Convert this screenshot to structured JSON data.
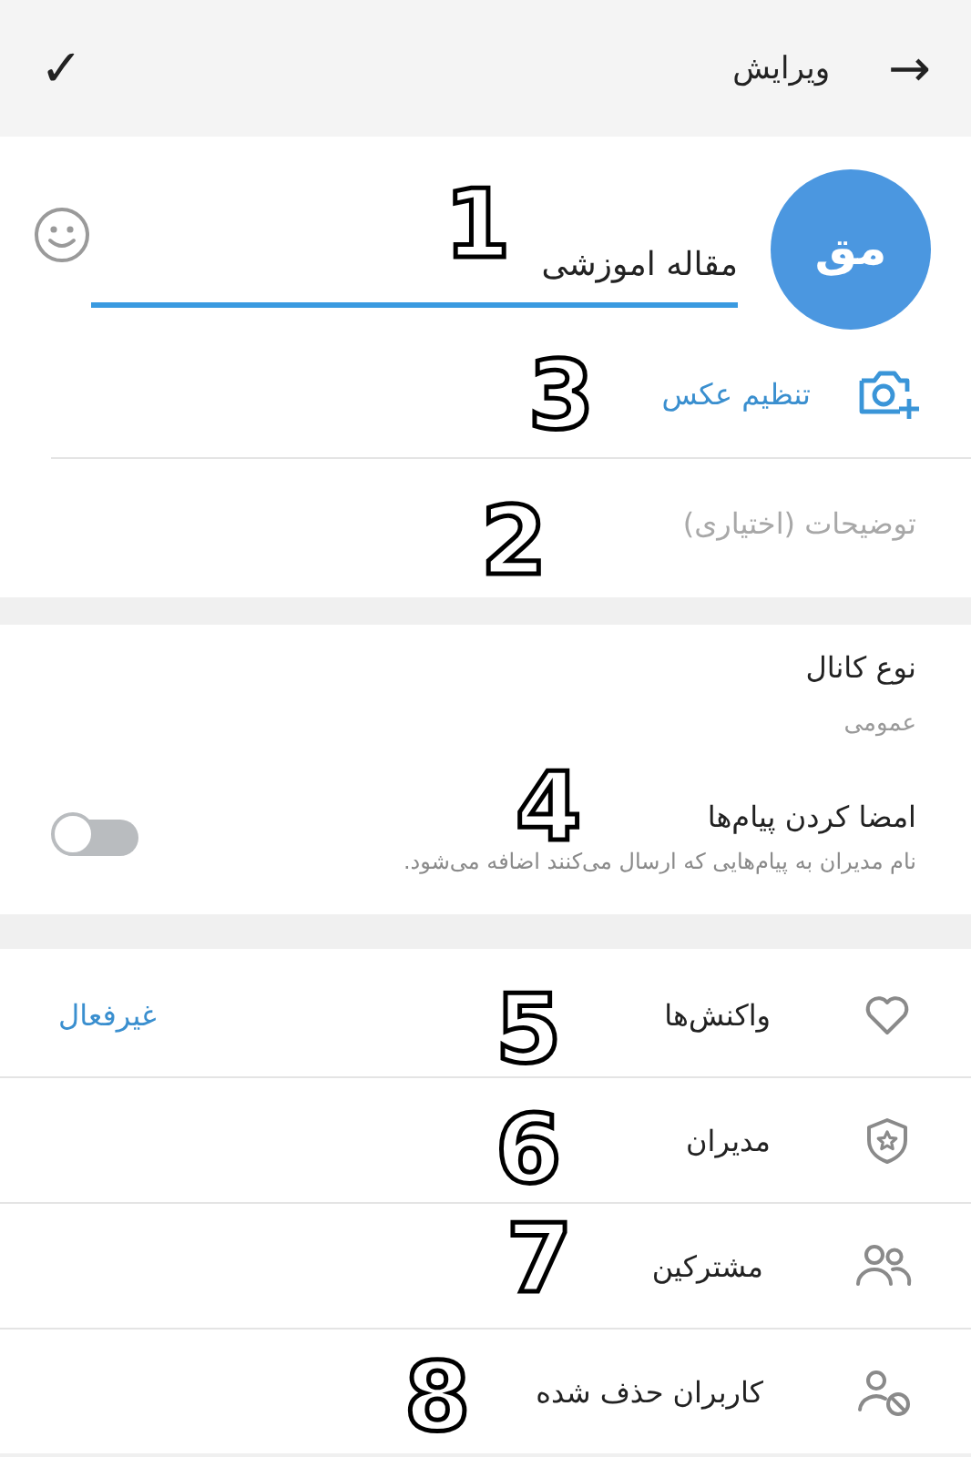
{
  "header": {
    "back_glyph": "→",
    "title": "ویرایش",
    "done_glyph": "✓"
  },
  "channel": {
    "avatar_initials": "مق",
    "name": "مقاله اموزشی",
    "set_photo": "تنظیم عکس",
    "description_placeholder": "توضیحات (اختیاری)"
  },
  "settings": {
    "channel_type_label": "نوع کانال",
    "channel_type_value": "عمومی",
    "sign_messages_label": "امضا کردن پیام‌ها",
    "sign_messages_hint": "نام مدیران به پیام‌هایی که ارسال می‌کنند اضافه می‌شود.",
    "sign_messages_on": false
  },
  "menu": [
    {
      "label": "واکنش‌ها",
      "value": "غیرفعال"
    },
    {
      "label": "مدیران"
    },
    {
      "label": "مشترکین"
    },
    {
      "label": "کاربران حذف شده"
    }
  ],
  "annotations": [
    {
      "label": "1"
    },
    {
      "label": "3"
    },
    {
      "label": "2"
    },
    {
      "label": "4"
    },
    {
      "label": "5"
    },
    {
      "label": "6"
    },
    {
      "label": "7"
    },
    {
      "label": "8"
    }
  ]
}
